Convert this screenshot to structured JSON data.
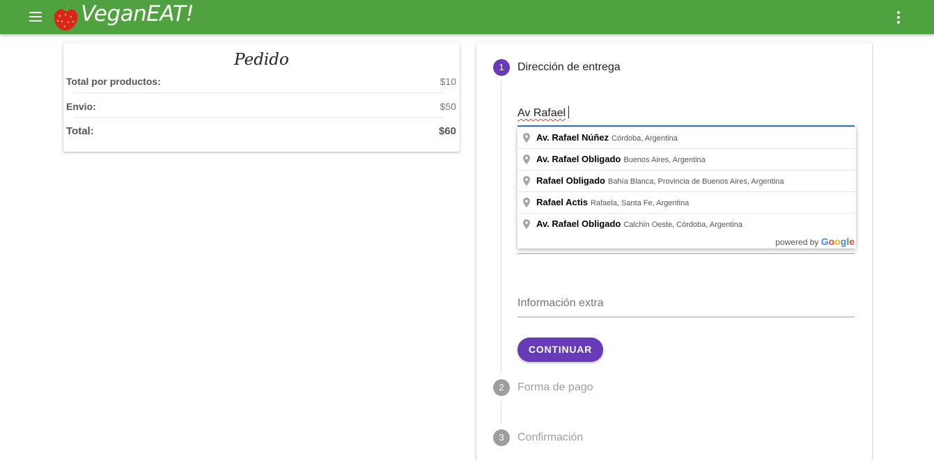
{
  "app": {
    "title": "VeganEAT!"
  },
  "order": {
    "title": "Pedido",
    "rows": [
      {
        "label": "Total por productos:",
        "value": "$10"
      },
      {
        "label": "Envio:",
        "value": "$50"
      },
      {
        "label": "Total:",
        "value": "$60"
      }
    ]
  },
  "stepper": {
    "steps": [
      {
        "number": "1",
        "label": "Dirección de entrega"
      },
      {
        "number": "2",
        "label": "Forma de pago"
      },
      {
        "number": "3",
        "label": "Confirmación"
      }
    ],
    "address_value": "Av Rafael",
    "extra_placeholder": "Información extra",
    "continue_label": "CONTINUAR"
  },
  "autocomplete": {
    "suggestions": [
      {
        "main": "Av. Rafael Núñez",
        "secondary": "Córdoba, Argentina"
      },
      {
        "main": "Av. Rafael Obligado",
        "secondary": "Buenos Aires, Argentina"
      },
      {
        "main": "Rafael Obligado",
        "secondary": "Bahía Blanca, Provincia de Buenos Aires, Argentina"
      },
      {
        "main": "Rafael Actis",
        "secondary": "Rafaela, Santa Fe, Argentina"
      },
      {
        "main": "Av. Rafael Obligado",
        "secondary": "Calchín Oeste, Córdoba, Argentina"
      }
    ],
    "powered_by": "powered by",
    "powered_brand": "Google"
  },
  "colors": {
    "appbar": "#4fa23f",
    "accent": "#673ab7",
    "inactive": "#9e9e9e",
    "input_focus": "#3a78c2"
  },
  "icons": [
    "menu-icon",
    "strawberry-logo-icon",
    "more-vert-icon",
    "map-pin-icon"
  ]
}
